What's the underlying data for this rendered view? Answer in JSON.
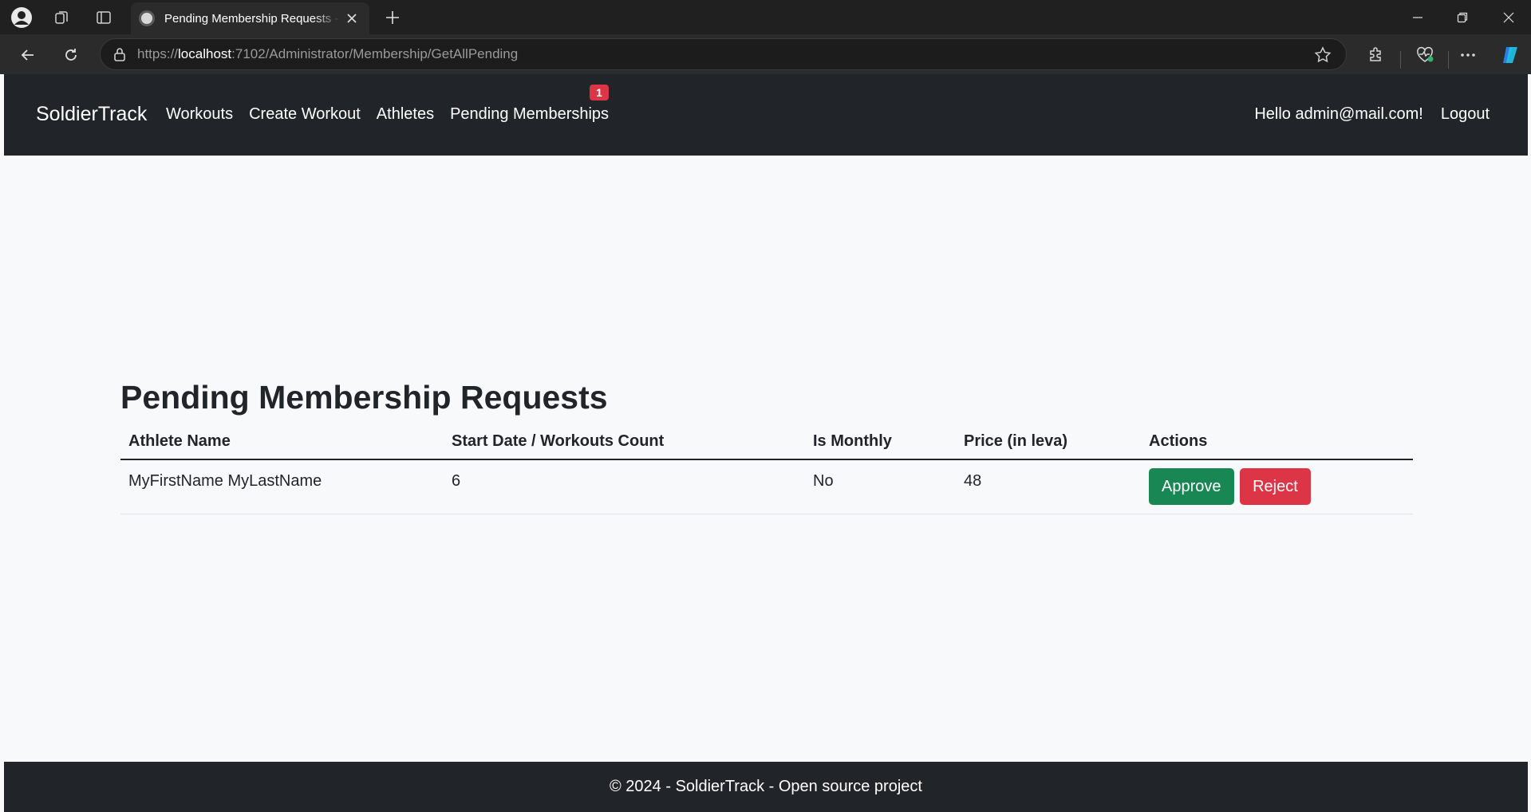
{
  "browser": {
    "tab_title": "Pending Membership Requests - SoldierTrack",
    "url_prefix": "https://",
    "url_host": "localhost",
    "url_rest": ":7102/Administrator/Membership/GetAllPending"
  },
  "navbar": {
    "brand": "SoldierTrack",
    "links": [
      "Workouts",
      "Create Workout",
      "Athletes",
      "Pending Memberships"
    ],
    "pending_badge": "1",
    "greeting": "Hello admin@mail.com!",
    "logout": "Logout"
  },
  "main": {
    "title": "Pending Membership Requests",
    "table": {
      "headers": [
        "Athlete Name",
        "Start Date / Workouts Count",
        "Is Monthly",
        "Price (in leva)",
        "Actions"
      ],
      "rows": [
        {
          "athlete": "MyFirstName MyLastName",
          "start_or_count": "6",
          "is_monthly": "No",
          "price": "48",
          "approve": "Approve",
          "reject": "Reject"
        }
      ]
    }
  },
  "footer": {
    "text": "© 2024 - SoldierTrack - Open source project"
  },
  "colors": {
    "navbar": "#212529",
    "approve": "#198754",
    "reject": "#dc3545",
    "page_bg": "#f8f9fa"
  }
}
